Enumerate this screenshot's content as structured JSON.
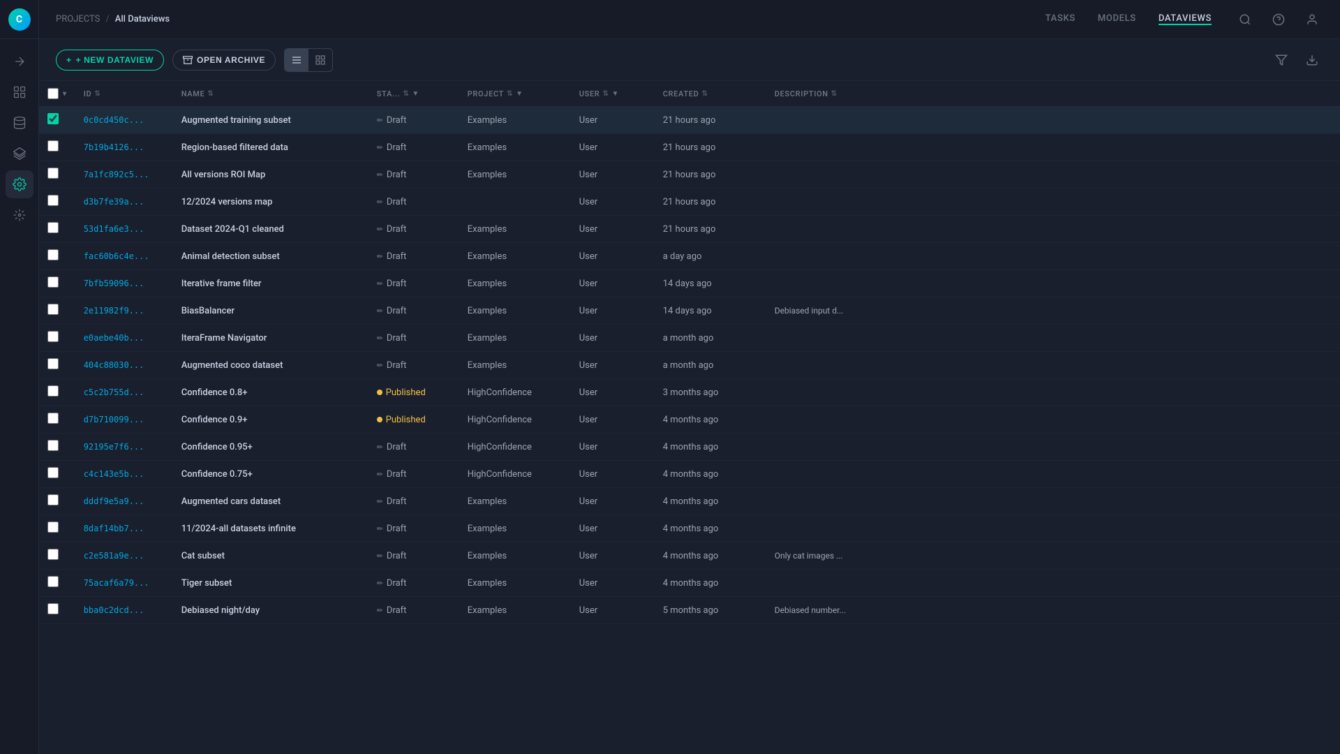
{
  "app": {
    "logo": "C",
    "breadcrumb": {
      "projects": "PROJECTS",
      "separator": "/",
      "current": "All Dataviews"
    }
  },
  "nav": {
    "links": [
      {
        "label": "TASKS",
        "active": false
      },
      {
        "label": "MODELS",
        "active": false
      },
      {
        "label": "DATAVIEWS",
        "active": true
      }
    ]
  },
  "toolbar": {
    "new_button": "+ NEW DATAVIEW",
    "archive_button": "OPEN ARCHIVE",
    "view_list_title": "List view",
    "view_grid_title": "Grid view"
  },
  "table": {
    "columns": [
      {
        "key": "id",
        "label": "ID",
        "sortable": true
      },
      {
        "key": "name",
        "label": "NAME",
        "sortable": true
      },
      {
        "key": "status",
        "label": "STA...",
        "sortable": true,
        "filtered": true
      },
      {
        "key": "project",
        "label": "PROJECT",
        "sortable": true,
        "filtered": true
      },
      {
        "key": "user",
        "label": "USER",
        "sortable": true,
        "filtered": true
      },
      {
        "key": "created",
        "label": "CREATED",
        "sortable": true
      },
      {
        "key": "description",
        "label": "DESCRIPTION",
        "sortable": true
      }
    ],
    "rows": [
      {
        "id": "0c0cd450c...",
        "name": "Augmented training subset",
        "status": "Draft",
        "status_type": "draft",
        "project": "Examples",
        "user": "User",
        "created": "21 hours ago",
        "description": "",
        "selected": true,
        "highlighted": true
      },
      {
        "id": "7b19b4126...",
        "name": "Region-based filtered data",
        "status": "Draft",
        "status_type": "draft",
        "project": "Examples",
        "user": "User",
        "created": "21 hours ago",
        "description": ""
      },
      {
        "id": "7a1fc892c5...",
        "name": "All versions ROI Map",
        "status": "Draft",
        "status_type": "draft",
        "project": "Examples",
        "user": "User",
        "created": "21 hours ago",
        "description": ""
      },
      {
        "id": "d3b7fe39a...",
        "name": "12/2024 versions map",
        "status": "Draft",
        "status_type": "draft",
        "project": "",
        "user": "User",
        "created": "21 hours ago",
        "description": ""
      },
      {
        "id": "53d1fa6e3...",
        "name": "Dataset 2024-Q1 cleaned",
        "status": "Draft",
        "status_type": "draft",
        "project": "Examples",
        "user": "User",
        "created": "21 hours ago",
        "description": ""
      },
      {
        "id": "fac60b6c4e...",
        "name": "Animal detection subset",
        "status": "Draft",
        "status_type": "draft",
        "project": "Examples",
        "user": "User",
        "created": "a day ago",
        "description": ""
      },
      {
        "id": "7bfb59096...",
        "name": "Iterative frame filter",
        "status": "Draft",
        "status_type": "draft",
        "project": "Examples",
        "user": "User",
        "created": "14 days ago",
        "description": ""
      },
      {
        "id": "2e11982f9...",
        "name": "BiasBalancer",
        "status": "Draft",
        "status_type": "draft",
        "project": "Examples",
        "user": "User",
        "created": "14 days ago",
        "description": "Debiased input d..."
      },
      {
        "id": "e0aebe40b...",
        "name": "IteraFrame Navigator",
        "status": "Draft",
        "status_type": "draft",
        "project": "Examples",
        "user": "User",
        "created": "a month ago",
        "description": ""
      },
      {
        "id": "404c88030...",
        "name": "Augmented coco dataset",
        "status": "Draft",
        "status_type": "draft",
        "project": "Examples",
        "user": "User",
        "created": "a month ago",
        "description": ""
      },
      {
        "id": "c5c2b755d...",
        "name": "Confidence 0.8+",
        "status": "Published",
        "status_type": "published",
        "project": "HighConfidence",
        "user": "User",
        "created": "3 months ago",
        "description": ""
      },
      {
        "id": "d7b710099...",
        "name": "Confidence 0.9+",
        "status": "Published",
        "status_type": "published",
        "project": "HighConfidence",
        "user": "User",
        "created": "4 months ago",
        "description": ""
      },
      {
        "id": "92195e7f6...",
        "name": "Confidence 0.95+",
        "status": "Draft",
        "status_type": "draft",
        "project": "HighConfidence",
        "user": "User",
        "created": "4 months ago",
        "description": ""
      },
      {
        "id": "c4c143e5b...",
        "name": "Confidence 0.75+",
        "status": "Draft",
        "status_type": "draft",
        "project": "HighConfidence",
        "user": "User",
        "created": "4 months ago",
        "description": ""
      },
      {
        "id": "dddf9e5a9...",
        "name": "Augmented cars dataset",
        "status": "Draft",
        "status_type": "draft",
        "project": "Examples",
        "user": "User",
        "created": "4 months ago",
        "description": ""
      },
      {
        "id": "8daf14bb7...",
        "name": "11/2024-all datasets infinite",
        "status": "Draft",
        "status_type": "draft",
        "project": "Examples",
        "user": "User",
        "created": "4 months ago",
        "description": ""
      },
      {
        "id": "c2e581a9e...",
        "name": "Cat subset",
        "status": "Draft",
        "status_type": "draft",
        "project": "Examples",
        "user": "User",
        "created": "4 months ago",
        "description": "Only cat images ..."
      },
      {
        "id": "75acaf6a79...",
        "name": "Tiger subset",
        "status": "Draft",
        "status_type": "draft",
        "project": "Examples",
        "user": "User",
        "created": "4 months ago",
        "description": ""
      },
      {
        "id": "bba0c2dcd...",
        "name": "Debiased night/day",
        "status": "Draft",
        "status_type": "draft",
        "project": "Examples",
        "user": "User",
        "created": "5 months ago",
        "description": "Debiased number..."
      }
    ]
  },
  "sidebar": {
    "items": [
      {
        "name": "pipeline-icon",
        "active": false
      },
      {
        "name": "dashboard-icon",
        "active": false
      },
      {
        "name": "datasets-icon",
        "active": false
      },
      {
        "name": "layers-icon",
        "active": false
      },
      {
        "name": "settings-icon",
        "active": true
      },
      {
        "name": "integrations-icon",
        "active": false
      }
    ]
  }
}
